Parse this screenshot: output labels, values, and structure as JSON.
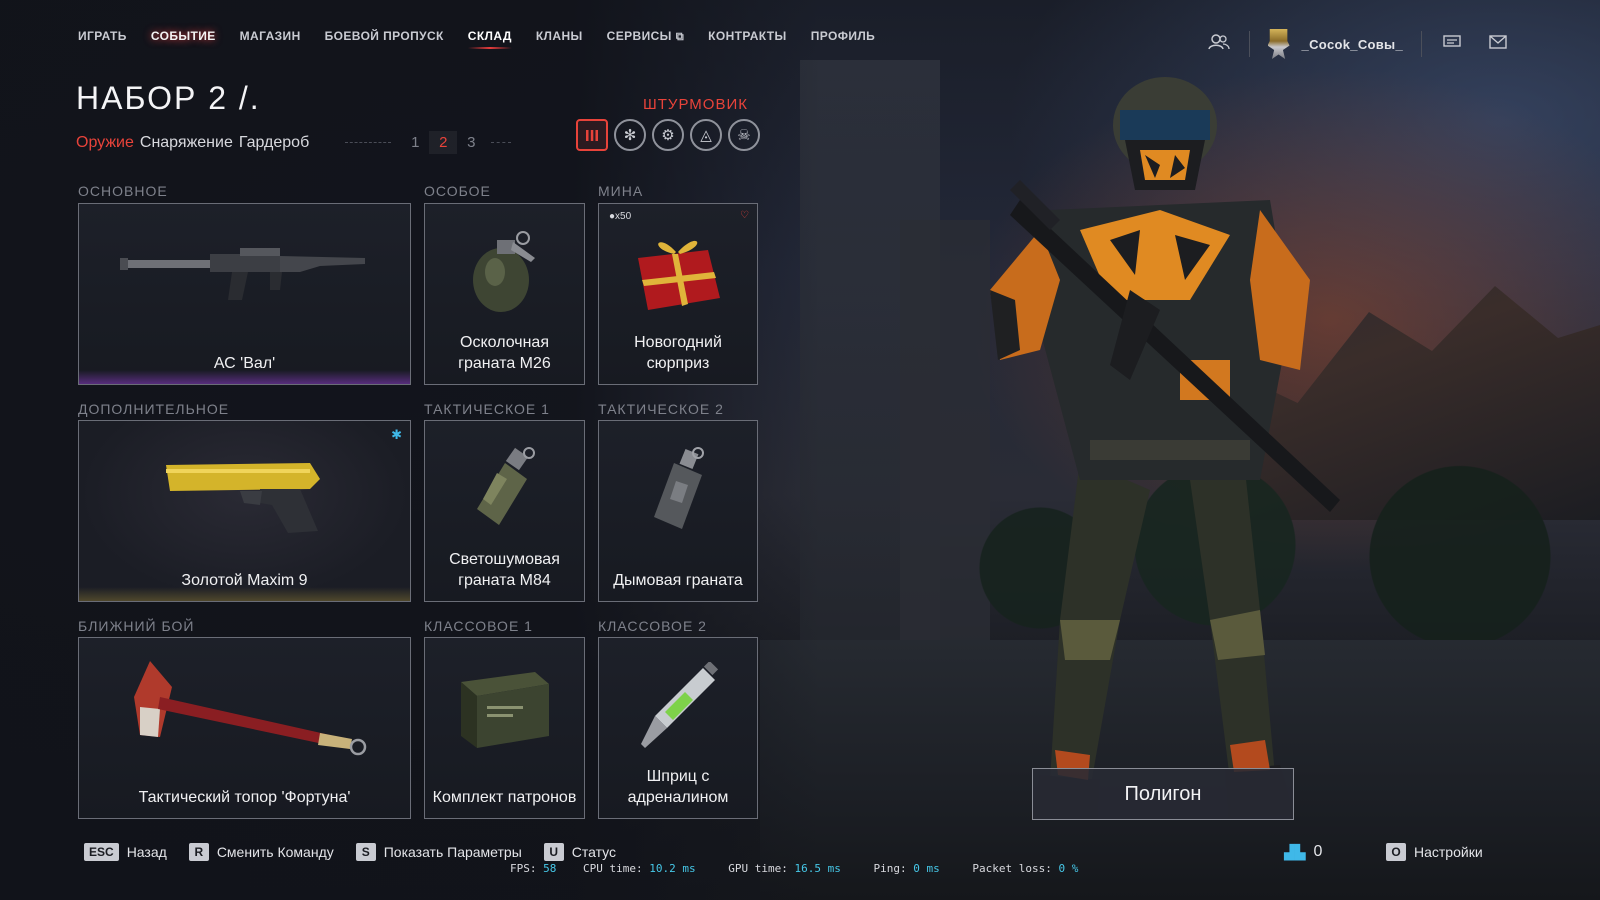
{
  "nav": {
    "items": [
      "ИГРАТЬ",
      "СОБЫТИЕ",
      "МАГАЗИН",
      "БОЕВОЙ ПРОПУСК",
      "СКЛАД",
      "КЛАНЫ",
      "СЕРВИСЫ",
      "КОНТРАКТЫ",
      "ПРОФИЛЬ"
    ],
    "active": "СКЛАД",
    "highlighted": "СОБЫТИЕ"
  },
  "profile": {
    "username": "_Cocok_Совы_",
    "icons": [
      "friends-icon",
      "chat-icon",
      "mail-icon"
    ]
  },
  "loadout": {
    "title": "НАБОР 2 /.",
    "tabs": [
      "Оружие",
      "Снаряжение",
      "Гардероб"
    ],
    "active_tab": "Оружие",
    "pages": [
      "1",
      "2",
      "3"
    ],
    "active_page": "2",
    "class_name": "ШТУРМОВИК",
    "class_icons": [
      "rifleman-icon",
      "medic-icon",
      "engineer-icon",
      "sniper-icon",
      "sed-icon"
    ]
  },
  "slots": {
    "primary": {
      "label": "ОСНОВНОЕ",
      "item": "АС 'Вал'"
    },
    "special": {
      "label": "ОСОБОЕ",
      "item": "Осколочная граната M26"
    },
    "mine": {
      "label": "МИНА",
      "item": "Новогодний сюрприз",
      "count": "x50"
    },
    "secondary": {
      "label": "ДОПОЛНИТЕЛЬНОЕ",
      "item": "Золотой Maxim 9"
    },
    "tactical1": {
      "label": "ТАКТИЧЕСКОЕ 1",
      "item": "Светошумовая граната M84"
    },
    "tactical2": {
      "label": "ТАКТИЧЕСКОЕ 2",
      "item": "Дымовая граната"
    },
    "melee": {
      "label": "БЛИЖНИЙ БОЙ",
      "item": "Тактический топор 'Фортуна'"
    },
    "class1": {
      "label": "КЛАССОВОЕ 1",
      "item": "Комплект патронов"
    },
    "class2": {
      "label": "КЛАССОВОЕ 2",
      "item": "Шприц с адреналином"
    }
  },
  "polygon_button": "Полигон",
  "hotkeys": [
    {
      "key": "ESC",
      "label": "Назад"
    },
    {
      "key": "R",
      "label": "Сменить Команду"
    },
    {
      "key": "S",
      "label": "Показать Параметры"
    },
    {
      "key": "U",
      "label": "Статус"
    }
  ],
  "perf": {
    "fps_label": "FPS:",
    "fps": "58",
    "cpu_label": "CPU time:",
    "cpu": "10.2",
    "cpu_unit": "ms",
    "gpu_label": "GPU time:",
    "gpu": "16.5",
    "gpu_unit": "ms",
    "ping_label": "Ping:",
    "ping": "0",
    "ping_unit": "ms",
    "loss_label": "Packet loss:",
    "loss": "0",
    "loss_unit": "%"
  },
  "online_count": "0",
  "settings": {
    "key": "O",
    "label": "Настройки"
  },
  "colors": {
    "accent": "#e8433a",
    "highlight": "#3fb8e8",
    "frame": "#6a6d77"
  }
}
